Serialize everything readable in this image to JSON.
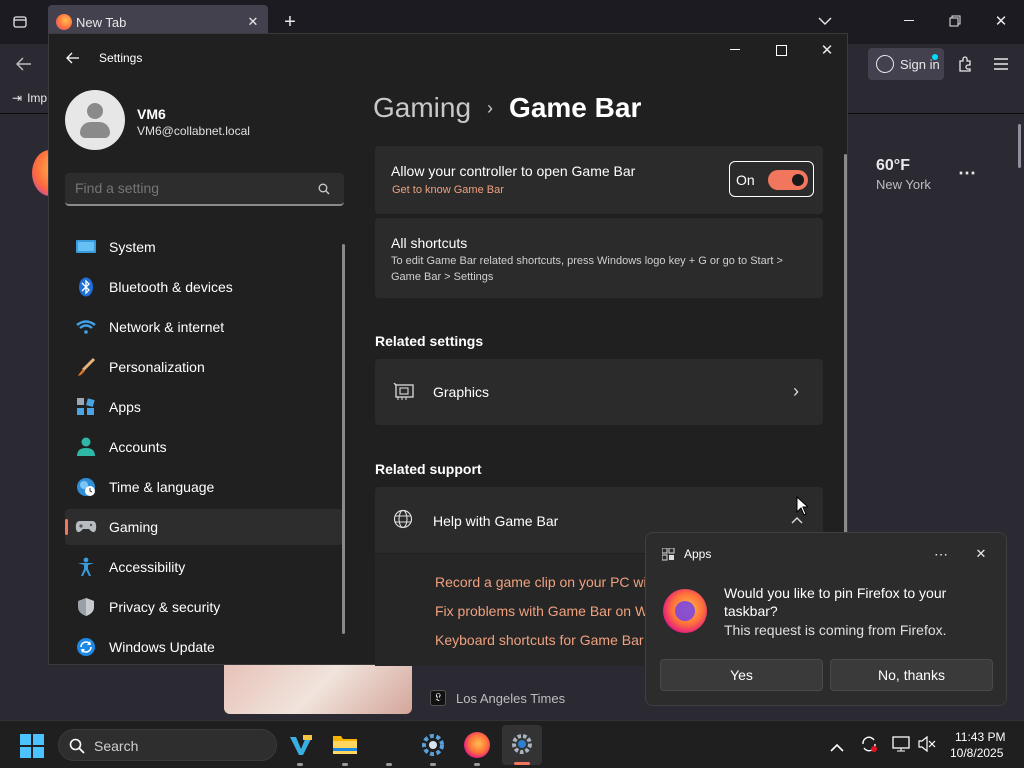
{
  "firefox": {
    "tab_title": "New Tab",
    "bookmark_import": "Imp",
    "sign_in": "Sign in",
    "weather_temp": "60°F",
    "weather_city": "New York",
    "news_source": "Los Angeles Times"
  },
  "settings": {
    "window_title": "Settings",
    "user_name": "VM6",
    "user_email": "VM6@collabnet.local",
    "search_placeholder": "Find a setting",
    "breadcrumb_parent": "Gaming",
    "breadcrumb_current": "Game Bar",
    "nav": [
      {
        "label": "System",
        "icon": "monitor-icon"
      },
      {
        "label": "Bluetooth & devices",
        "icon": "bluetooth-icon"
      },
      {
        "label": "Network & internet",
        "icon": "wifi-icon"
      },
      {
        "label": "Personalization",
        "icon": "brush-icon"
      },
      {
        "label": "Apps",
        "icon": "apps-icon"
      },
      {
        "label": "Accounts",
        "icon": "person-icon"
      },
      {
        "label": "Time & language",
        "icon": "globe-clock-icon"
      },
      {
        "label": "Gaming",
        "icon": "gamepad-icon"
      },
      {
        "label": "Accessibility",
        "icon": "accessibility-icon"
      },
      {
        "label": "Privacy & security",
        "icon": "shield-icon"
      },
      {
        "label": "Windows Update",
        "icon": "update-icon"
      }
    ],
    "selected_nav": "Gaming",
    "controller_title": "Allow your controller to open Game Bar",
    "controller_link": "Get to know Game Bar",
    "toggle_state": "On",
    "shortcuts_title": "All shortcuts",
    "shortcuts_desc": "To edit Game Bar related shortcuts, press Windows logo key + G or go to Start > Game Bar > Settings",
    "related_settings_heading": "Related settings",
    "graphics_label": "Graphics",
    "related_support_heading": "Related support",
    "help_label": "Help with Game Bar",
    "help_links": [
      "Record a game clip on your PC wit",
      "Fix problems with Game Bar on W",
      "Keyboard shortcuts for Game Bar"
    ]
  },
  "toast": {
    "app_name": "Apps",
    "message": "Would you like to pin Firefox to your taskbar?",
    "sub": "This request is coming from Firefox.",
    "yes": "Yes",
    "no": "No, thanks"
  },
  "taskbar": {
    "search": "Search",
    "time": "11:43 PM",
    "date": "10/8/2025"
  },
  "colors": {
    "accent": "#f0775e",
    "link": "#f0a17f",
    "firefox_bg": "#2b2a33",
    "settings_bg": "#202020"
  }
}
